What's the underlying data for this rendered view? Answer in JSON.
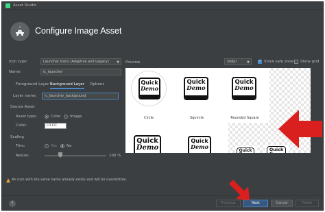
{
  "window": {
    "title": "Asset Studio",
    "header_title": "Configure Image Asset"
  },
  "form": {
    "icon_type_label": "Icon type:",
    "icon_type_value": "Launcher Icons (Adaptive and Legacy)",
    "name_label": "Name:",
    "name_value": "ic_launcher",
    "tabs": [
      {
        "label": "Foreground Layer",
        "active": false
      },
      {
        "label": "Background Layer",
        "active": true
      },
      {
        "label": "Options",
        "active": false
      }
    ],
    "layer_name_label": "Layer name:",
    "layer_name_value": "ic_launcher_background",
    "source_asset_label": "Source Asset",
    "asset_type_label": "Asset type:",
    "asset_type_options": [
      "Color",
      "Image"
    ],
    "asset_type_selected": "Color",
    "color_label": "Color:",
    "color_value": "FFFFFF",
    "scaling_label": "Scaling",
    "trim_label": "Trim:",
    "trim_options": [
      "Yes",
      "No"
    ],
    "trim_selected": "No",
    "resize_label": "Resize:",
    "resize_value": "100 %",
    "resize_percent": 100
  },
  "preview": {
    "label": "Preview",
    "density": "xhdpi",
    "show_safe_zone_label": "Show safe zone",
    "show_safe_zone": true,
    "show_grid_label": "Show grid",
    "show_grid": false,
    "icon_text_line1": "Quick",
    "icon_text_line2": "Demo",
    "shapes": [
      "Circle",
      "Squircle",
      "Rounded Square"
    ]
  },
  "warning": "An icon with the same name already exists and will be overwritten.",
  "footer": {
    "help": "?",
    "previous": "Previous",
    "next": "Next",
    "cancel": "Cancel",
    "finish": "Finish"
  },
  "colors": {
    "window_bg": "#3c3f41",
    "accent": "#4a88c7",
    "annotation_arrow": "#d9201e"
  }
}
